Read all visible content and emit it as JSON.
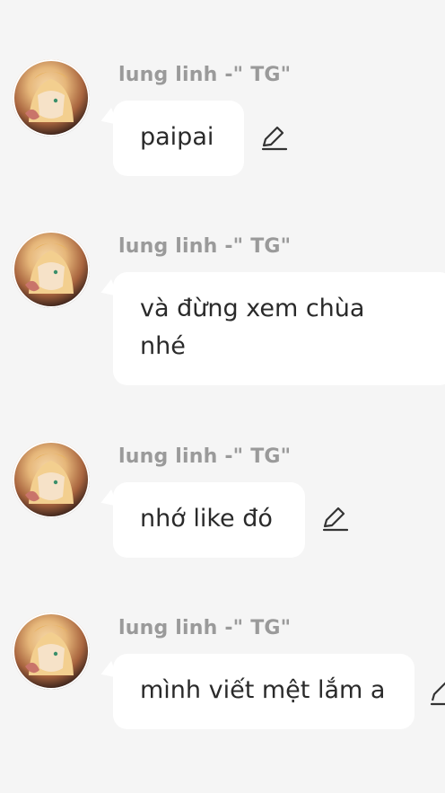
{
  "messages": [
    {
      "sender": "lung linh -\" TG\"",
      "text": "paipai",
      "editable": true
    },
    {
      "sender": "lung linh -\" TG\"",
      "text": "và đừng xem chùa nhé",
      "editable": false
    },
    {
      "sender": "lung linh -\" TG\"",
      "text": "nhớ like đó",
      "editable": true
    },
    {
      "sender": "lung linh -\" TG\"",
      "text": "mình viết mệt lắm a",
      "editable": true
    }
  ],
  "icons": {
    "avatar": "avatar-image",
    "edit": "pencil-icon"
  },
  "colors": {
    "background": "#f5f5f5",
    "bubble": "#ffffff",
    "sender": "#9a9a9a",
    "text": "#2a2a2a"
  }
}
